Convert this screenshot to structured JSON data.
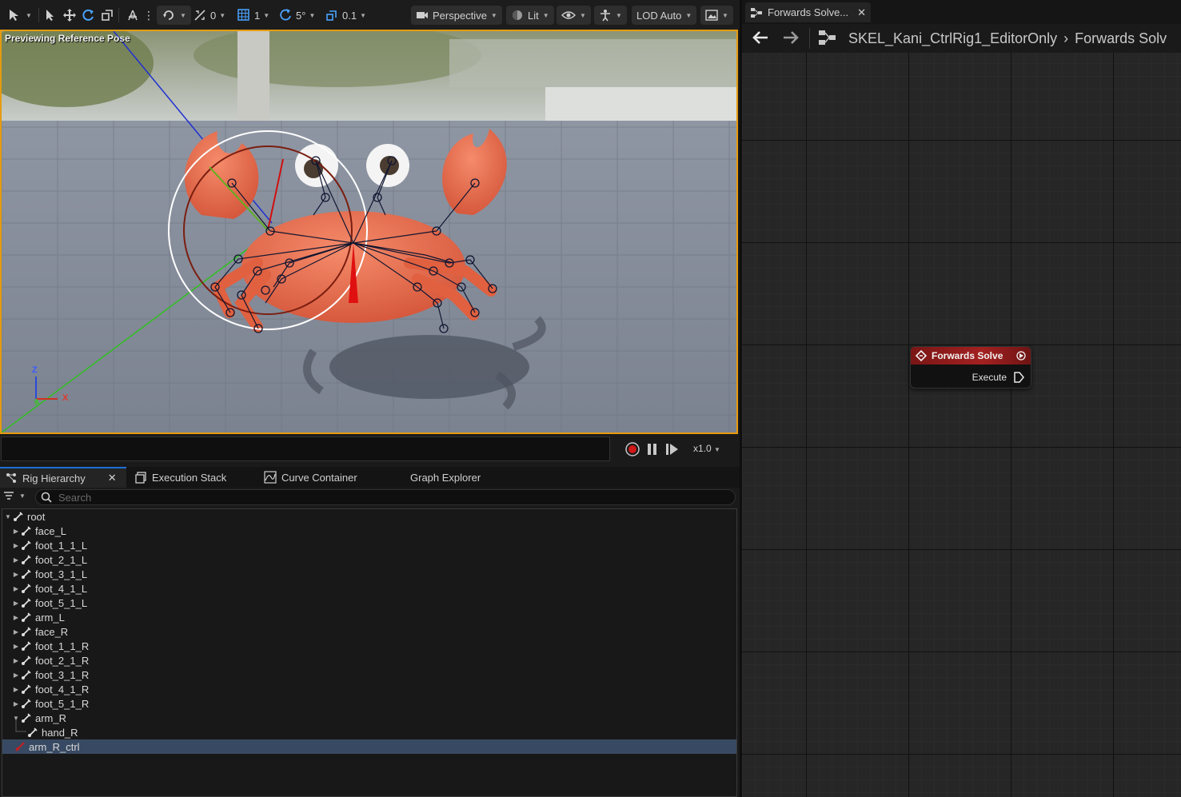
{
  "viewport": {
    "toolbar": {
      "grid_snap_value": "0",
      "grid_size_value": "1",
      "rotation_snap_value": "5°",
      "scale_snap_value": "0.1",
      "perspective_label": "Perspective",
      "lit_label": "Lit",
      "lod_label": "LOD Auto"
    },
    "preview_label": "Previewing Reference Pose",
    "axes": {
      "z": "Z",
      "x": "X",
      "y": "Y"
    },
    "playback_speed": "x1.0"
  },
  "tabs": [
    {
      "label": "Rig Hierarchy",
      "active": true
    },
    {
      "label": "Execution Stack"
    },
    {
      "label": "Curve Container"
    },
    {
      "label": "Graph Explorer"
    }
  ],
  "search": {
    "placeholder": "Search"
  },
  "hierarchy": [
    {
      "label": "root",
      "depth": 0,
      "expanded": true
    },
    {
      "label": "face_L",
      "depth": 1
    },
    {
      "label": "foot_1_1_L",
      "depth": 1
    },
    {
      "label": "foot_2_1_L",
      "depth": 1
    },
    {
      "label": "foot_3_1_L",
      "depth": 1
    },
    {
      "label": "foot_4_1_L",
      "depth": 1
    },
    {
      "label": "foot_5_1_L",
      "depth": 1
    },
    {
      "label": "arm_L",
      "depth": 1
    },
    {
      "label": "face_R",
      "depth": 1
    },
    {
      "label": "foot_1_1_R",
      "depth": 1
    },
    {
      "label": "foot_2_1_R",
      "depth": 1
    },
    {
      "label": "foot_3_1_R",
      "depth": 1
    },
    {
      "label": "foot_4_1_R",
      "depth": 1
    },
    {
      "label": "foot_5_1_R",
      "depth": 1
    },
    {
      "label": "arm_R",
      "depth": 1,
      "expanded": true
    },
    {
      "label": "hand_R",
      "depth": 2,
      "leaf": true
    },
    {
      "label": "arm_R_ctrl",
      "depth": 0,
      "selected": true,
      "control": true
    }
  ],
  "graph_panel": {
    "tab_label": "Forwards Solve...",
    "breadcrumb_root": "SKEL_Kani_CtrlRig1_EditorOnly",
    "breadcrumb_current": "Forwards Solv",
    "node": {
      "title": "Forwards Solve",
      "pin_label": "Execute"
    }
  },
  "colors": {
    "accent_orange": "#e59b10",
    "tab_active_blue": "#1e6fd6",
    "node_header_red": "#a32020",
    "selection_blue": "#384a63",
    "crab_body": "#e8694a"
  }
}
